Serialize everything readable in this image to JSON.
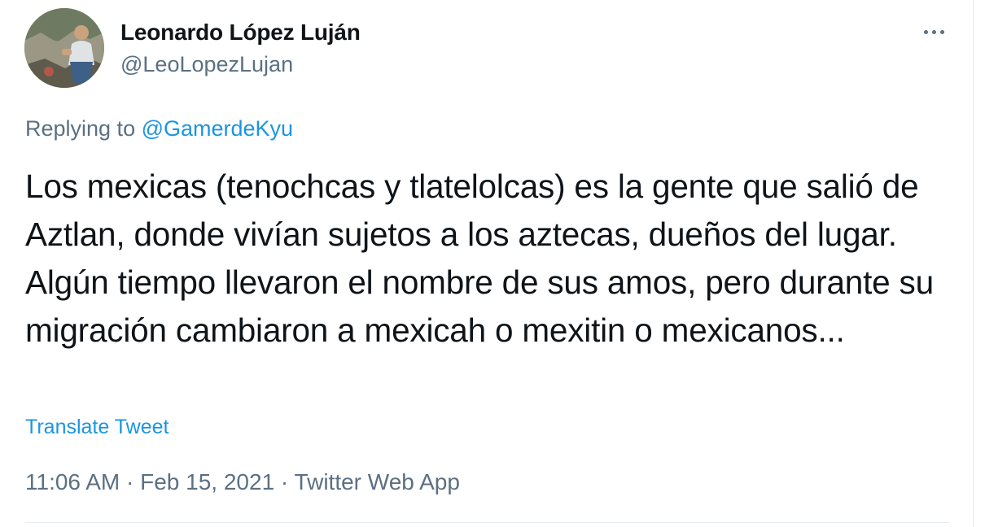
{
  "tweet": {
    "author": {
      "display_name": "Leonardo López Luján",
      "handle": "@LeoLopezLujan",
      "avatar_icon": "profile-photo"
    },
    "more_icon": "more-horizontal-icon",
    "reply": {
      "prefix": "Replying to ",
      "target": "@GamerdeKyu"
    },
    "text": "Los mexicas (tenochcas y tlatelolcas) es la gente que salió de Aztlan, donde vivían sujetos a los aztecas, dueños del lugar. Algún tiempo llevaron el nombre de sus amos, pero durante su migración cambiaron a mexicah o mexitin o mexicanos...",
    "translate_label": "Translate Tweet",
    "meta": {
      "time": "11:06 AM",
      "separator": " · ",
      "date": "Feb 15, 2021",
      "source": "Twitter Web App"
    },
    "colors": {
      "link": "#1b95e0",
      "secondary_text": "#5b7083",
      "primary_text": "#0f1419",
      "divider": "#e6ecf0"
    }
  }
}
